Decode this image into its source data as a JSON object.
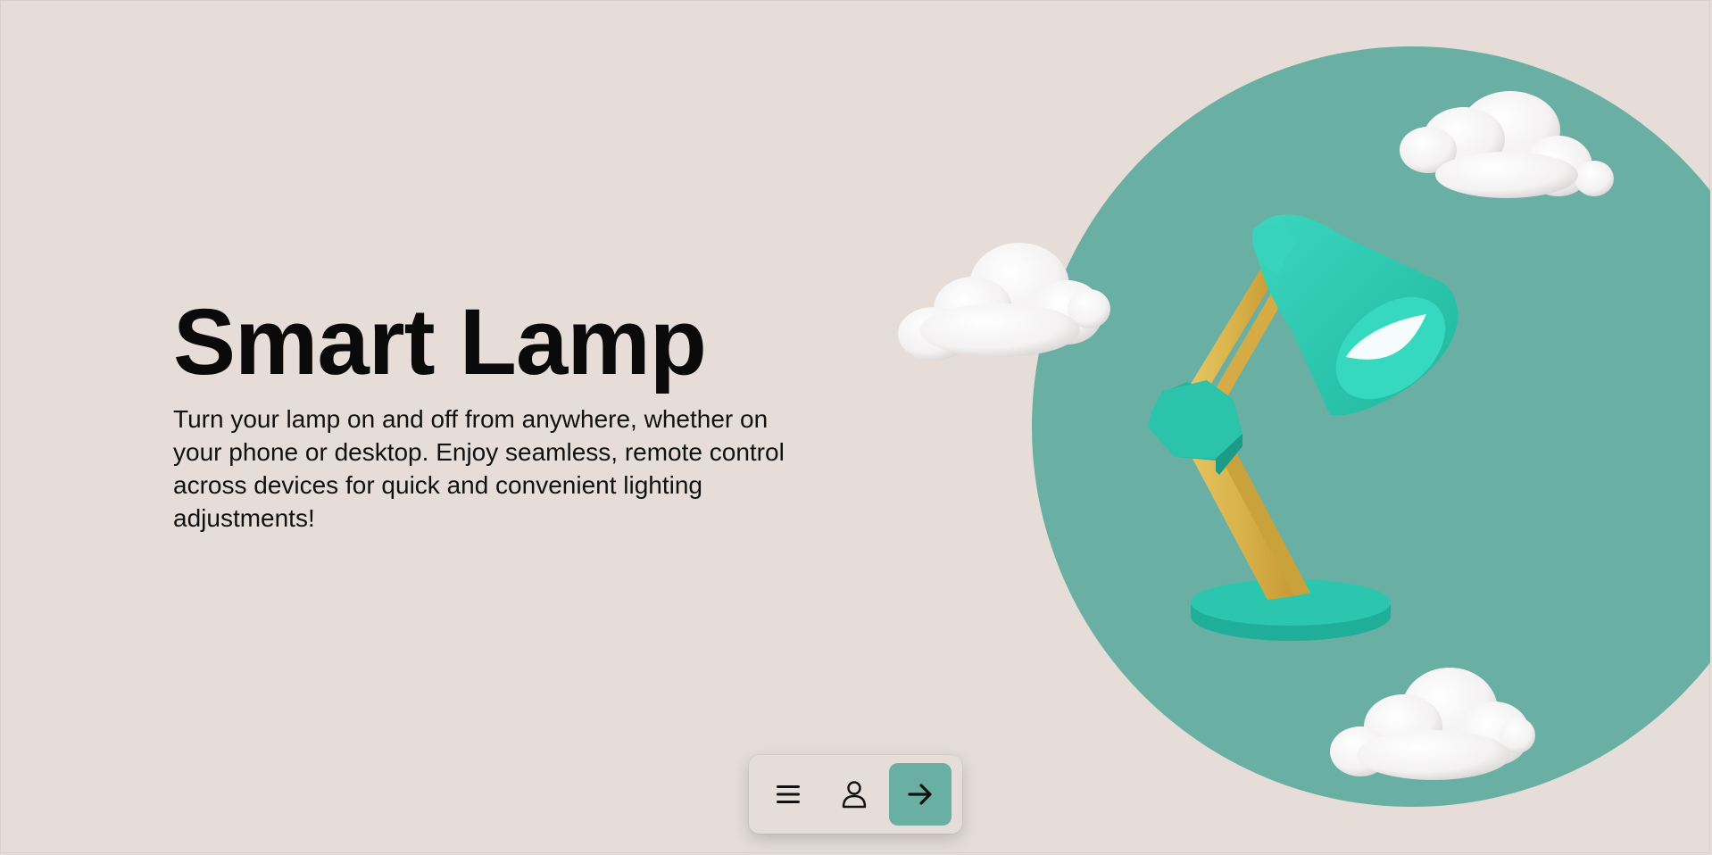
{
  "hero": {
    "title": "Smart Lamp",
    "description": "Turn your lamp on and off from anywhere, whether on your phone or desktop. Enjoy seamless, remote control across devices for quick and convenient lighting adjustments!"
  },
  "illustration": {
    "subject": "desk-lamp",
    "circle_color": "#6aafa3",
    "lamp_color": "#2cc6ae",
    "arm_color": "#e0bd55"
  },
  "dock": {
    "items": [
      {
        "icon": "menu-icon",
        "active": false
      },
      {
        "icon": "user-icon",
        "active": false
      },
      {
        "icon": "arrow-right-icon",
        "active": true
      }
    ],
    "accent": "#6aafa3"
  },
  "colors": {
    "background": "#e6ddd8",
    "text": "#0a0a0a"
  }
}
